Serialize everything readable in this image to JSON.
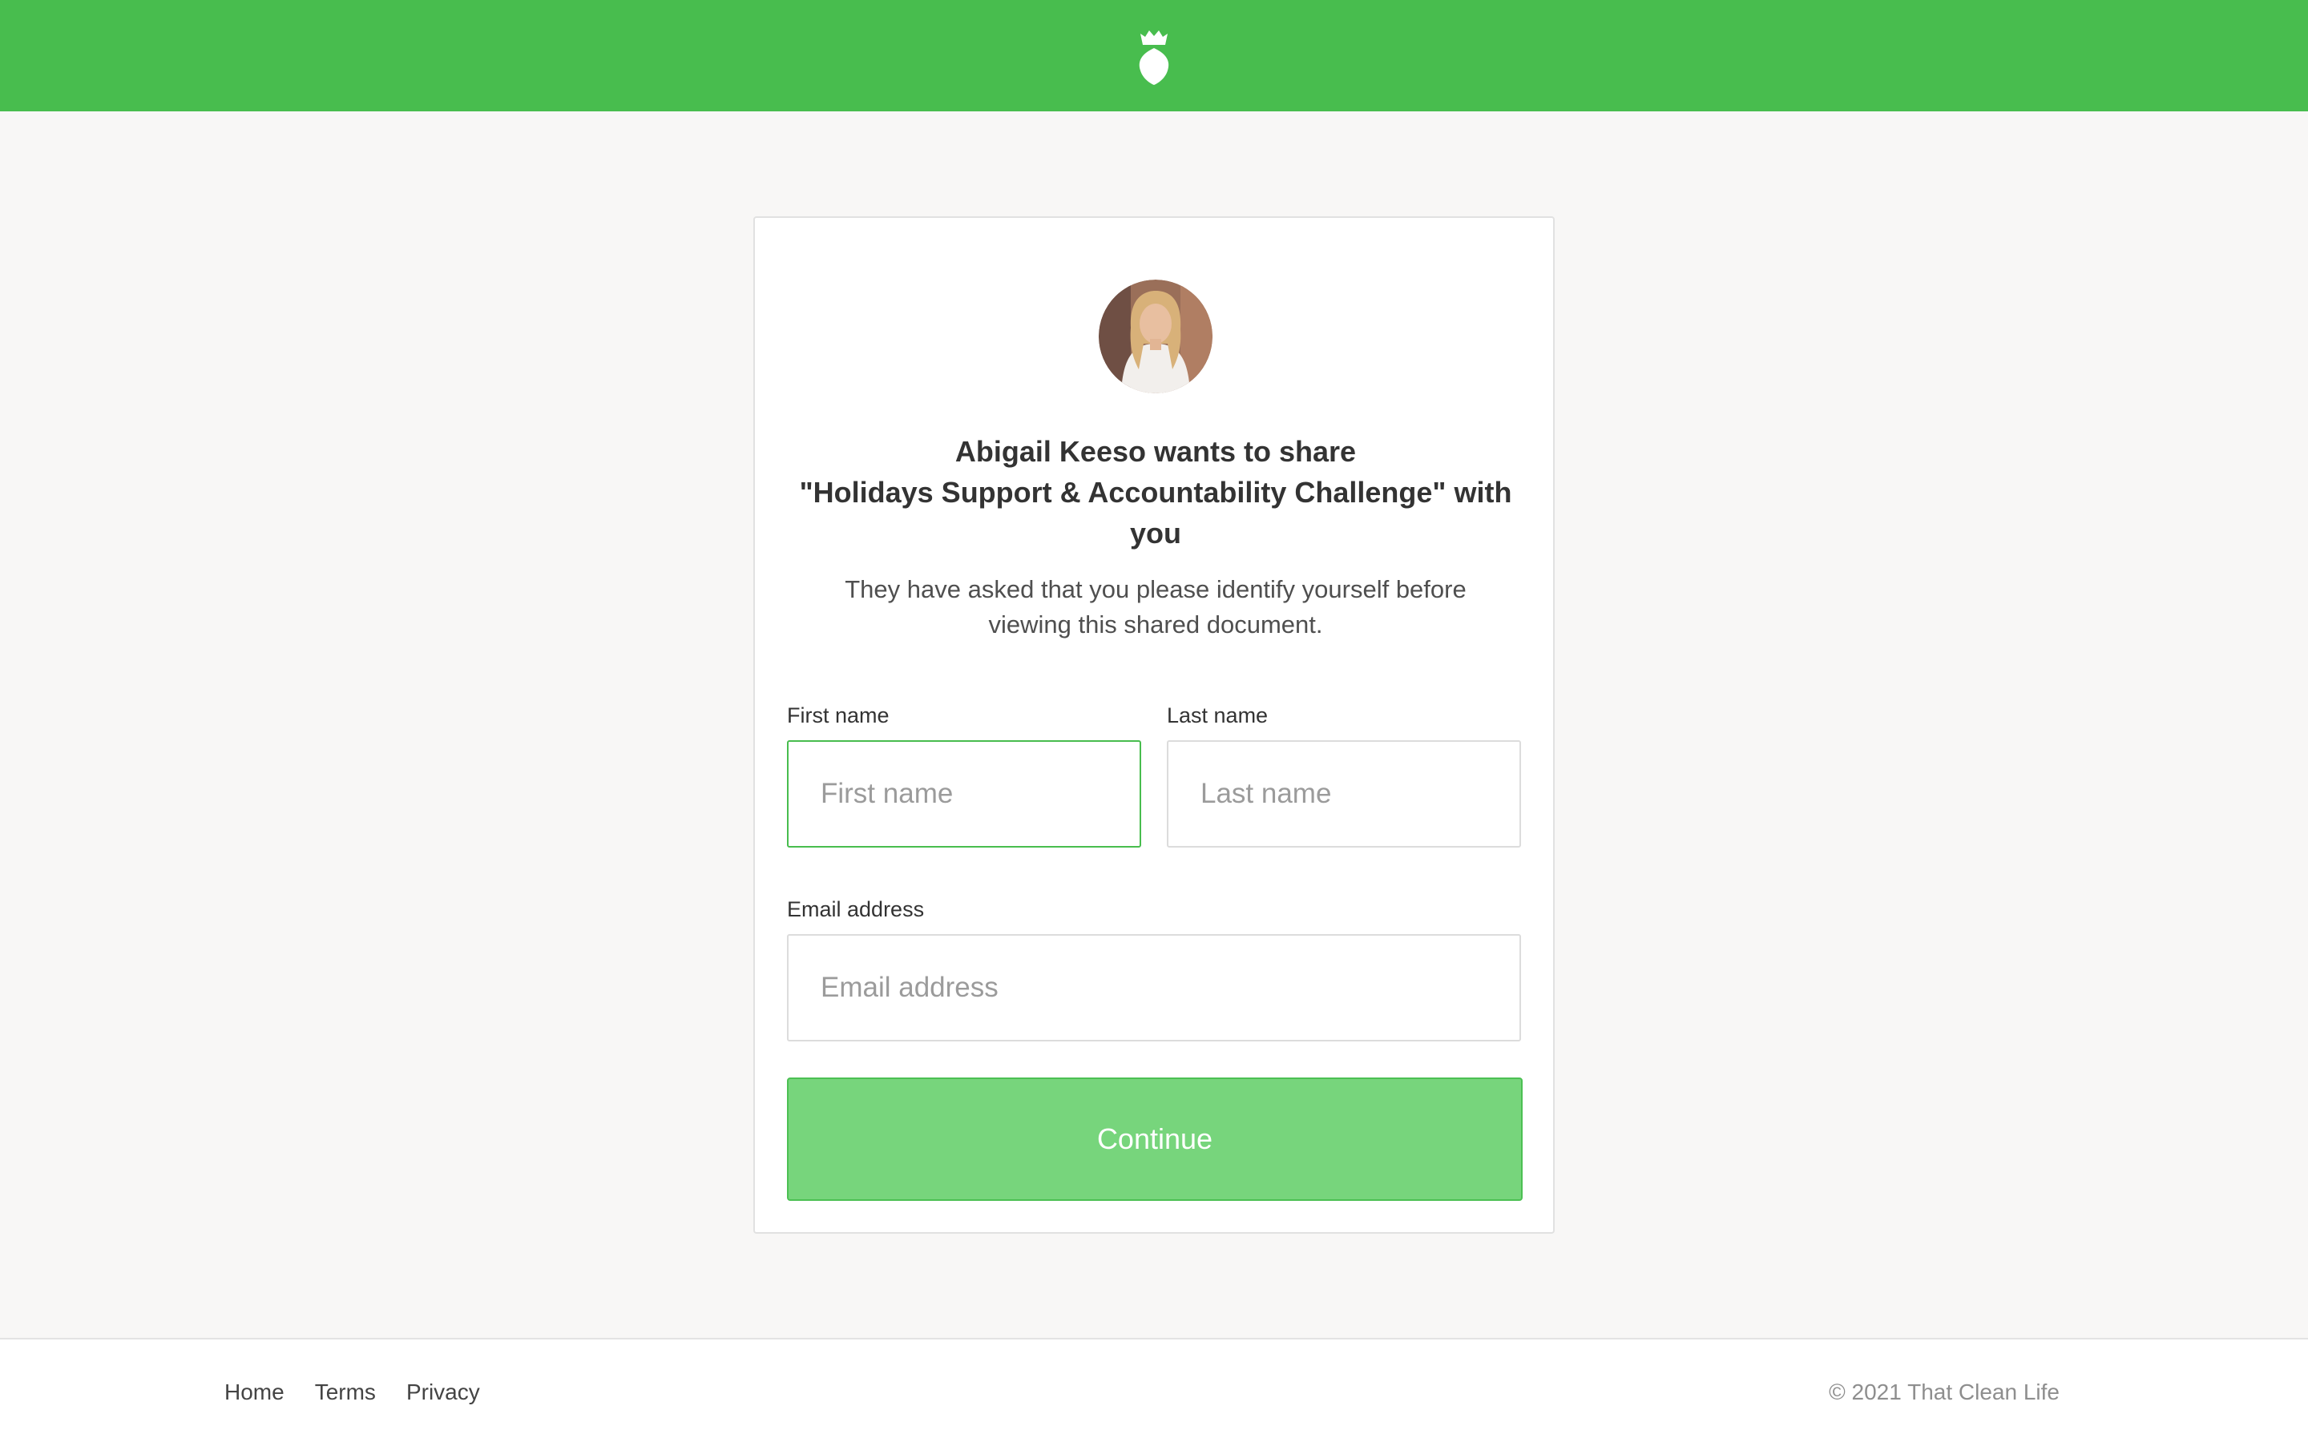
{
  "header": {
    "logo_icon": "leaf-crown-logo-icon",
    "brand_color": "#48bd4e"
  },
  "card": {
    "avatar_icon": "avatar",
    "heading_line1": "Abigail Keeso wants to share",
    "heading_line2": "\"Holidays Support & Accountability Challenge\" with",
    "heading_line3": "you",
    "subtext": "They have asked that you please identify yourself before viewing this shared document.",
    "form": {
      "first_name_label": "First name",
      "first_name_placeholder": "First name",
      "first_name_value": "",
      "last_name_label": "Last name",
      "last_name_placeholder": "Last name",
      "last_name_value": "",
      "email_label": "Email address",
      "email_placeholder": "Email address",
      "email_value": "",
      "continue_label": "Continue"
    }
  },
  "footer": {
    "links": [
      "Home",
      "Terms",
      "Privacy"
    ],
    "copyright": "© 2021 That Clean Life"
  }
}
